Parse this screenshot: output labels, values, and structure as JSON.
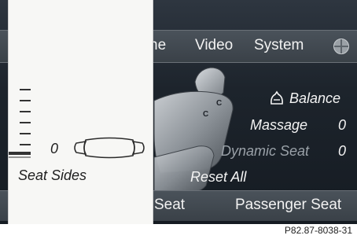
{
  "header": {
    "tabs": [
      {
        "label": "ne"
      },
      {
        "label": "Video"
      },
      {
        "label": "System"
      }
    ]
  },
  "menu": {
    "balance_label": "Balance",
    "massage_label": "Massage",
    "massage_value": "0",
    "dynamic_seat_label": "Dynamic Seat",
    "dynamic_seat_value": "0",
    "reset_all_label": "Reset All"
  },
  "footer": {
    "seat_tab": "Seat",
    "passenger_seat_tab": "Passenger Seat"
  },
  "popup": {
    "level_value": "0",
    "level_fraction": 0,
    "seat_sides_label": "Seat Sides"
  },
  "caption": "P82.87-8038-31",
  "colors": {
    "screen_bg": "#1d242c",
    "bar_bg": "#444c54",
    "text_light": "#f4f4f4",
    "text_dim": "#9aa1a8",
    "popup_bg": "#f7f7f5"
  }
}
